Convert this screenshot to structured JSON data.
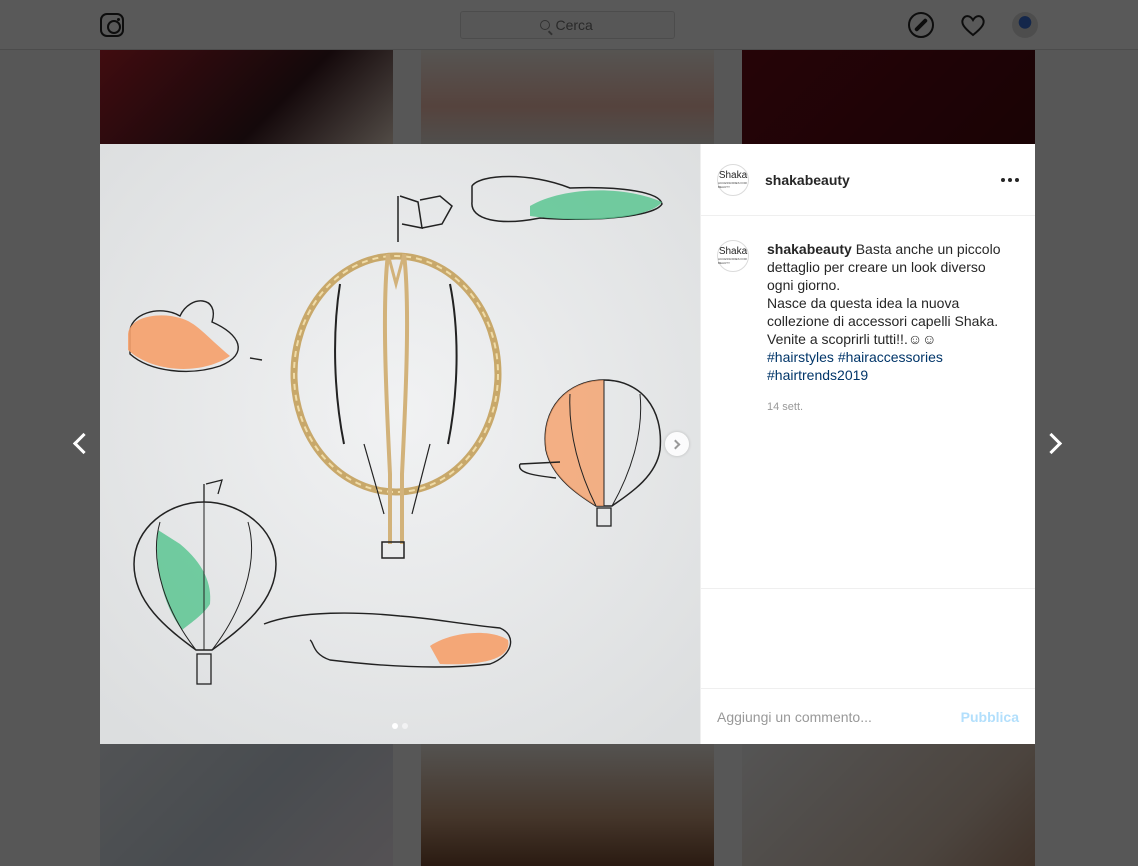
{
  "topbar": {
    "search_placeholder": "Cerca",
    "icons": [
      "instagram-logo",
      "compass-icon",
      "heart-icon",
      "profile-avatar"
    ]
  },
  "post": {
    "username": "shakabeauty",
    "avatar_text": "Shaka",
    "avatar_subtext": "ACCESSORIES FOR BEAUTY",
    "caption_lines": [
      "Basta anche un piccolo dettaglio per creare un look diverso ogni giorno.",
      "Nasce da questa idea la nuova collezione di accessori capelli Shaka.",
      "Venite a scoprirli tutti!!.☺☺"
    ],
    "hashtags": [
      "#hairstyles",
      "#hairaccessories",
      "#hairtrends2019"
    ],
    "timestamp": "14 sett.",
    "carousel": {
      "total": 2,
      "current": 1
    }
  },
  "comment_box": {
    "placeholder": "Aggiungi un commento...",
    "publish_label": "Pubblica"
  },
  "colors": {
    "accent_orange": "#f5a06a",
    "accent_green": "#5cc592",
    "link": "#003569",
    "publish_disabled": "#b2dffc"
  }
}
